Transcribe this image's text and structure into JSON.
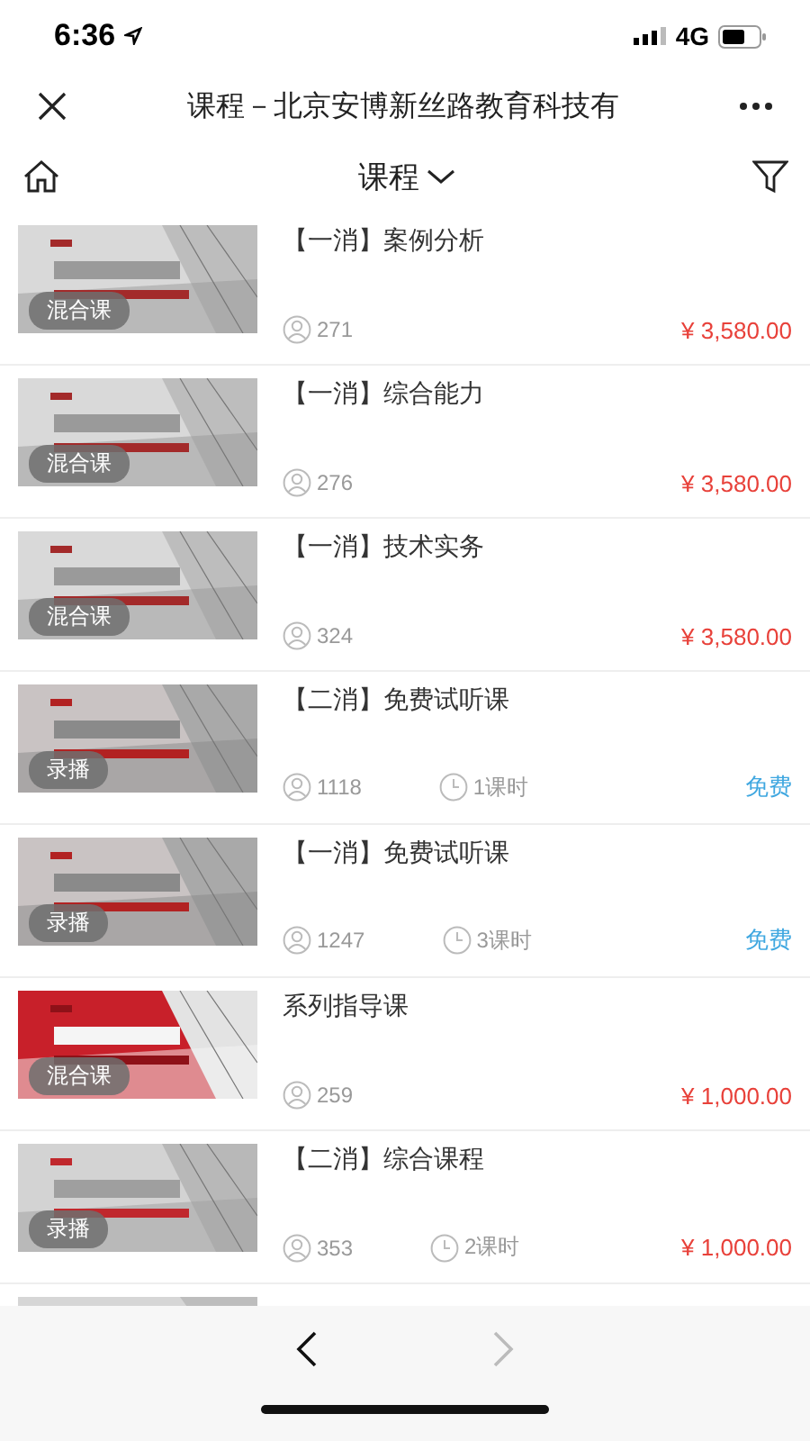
{
  "status_bar": {
    "time": "6:36",
    "network": "4G"
  },
  "title_bar": {
    "title": "课程－北京安博新丝路教育科技有"
  },
  "header": {
    "title": "课程"
  },
  "courses": [
    {
      "title": "【一消】案例分析",
      "badge": "混合课",
      "students": "271",
      "price": {
        "text": "¥ 3,580.00",
        "kind": "paid"
      }
    },
    {
      "title": "【一消】综合能力",
      "badge": "混合课",
      "students": "276",
      "price": {
        "text": "¥ 3,580.00",
        "kind": "paid"
      }
    },
    {
      "title": "【一消】技术实务",
      "badge": "混合课",
      "students": "324",
      "price": {
        "text": "¥ 3,580.00",
        "kind": "paid"
      }
    },
    {
      "title": "【二消】免费试听课",
      "badge": "录播",
      "students": "1118",
      "lessons": "1课时",
      "price": {
        "text": "免费",
        "kind": "free"
      }
    },
    {
      "title": "【一消】免费试听课",
      "badge": "录播",
      "students": "1247",
      "lessons": "3课时",
      "price": {
        "text": "免费",
        "kind": "free"
      }
    },
    {
      "title": "系列指导课",
      "badge": "混合课",
      "students": "259",
      "price": {
        "text": "¥ 1,000.00",
        "kind": "paid"
      }
    },
    {
      "title": "【二消】综合课程",
      "badge": "录播",
      "students": "353",
      "lessons": "2课时",
      "price": {
        "text": "¥ 1,000.00",
        "kind": "paid"
      }
    }
  ],
  "nav": {
    "back": {
      "disabled": false
    },
    "forward": {
      "disabled": true
    }
  }
}
